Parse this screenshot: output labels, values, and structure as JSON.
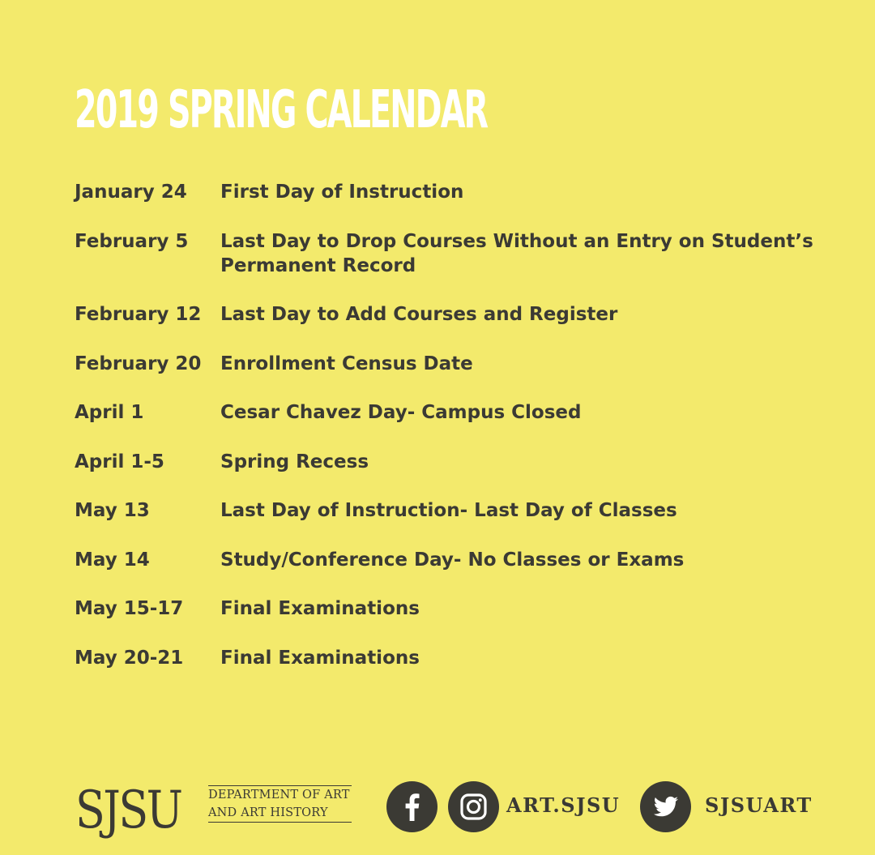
{
  "title": "2019 SPRING CALENDAR",
  "events": [
    {
      "date": "January 24",
      "desc": "First Day of Instruction"
    },
    {
      "date": "February 5",
      "desc": "Last Day to Drop Courses Without an Entry on Student’s Permanent Record"
    },
    {
      "date": "February 12",
      "desc": "Last Day to Add Courses and Register"
    },
    {
      "date": "February 20",
      "desc": "Enrollment Census Date"
    },
    {
      "date": "April 1",
      "desc": "Cesar Chavez Day- Campus Closed"
    },
    {
      "date": "April 1-5",
      "desc": "Spring Recess"
    },
    {
      "date": "May 13",
      "desc": "Last Day of Instruction- Last Day of Classes"
    },
    {
      "date": "May 14",
      "desc": "Study/Conference Day- No Classes or Exams"
    },
    {
      "date": "May 15-17",
      "desc": "Final Examinations"
    },
    {
      "date": "May 20-21",
      "desc": "Final Examinations"
    }
  ],
  "footer": {
    "logo": "SJSU",
    "dept_line1": "DEPARTMENT OF ART",
    "dept_line2": "AND ART HISTORY",
    "instagram_handle": "ART.SJSU",
    "twitter_handle": "SJSUART",
    "icons": [
      "facebook-icon",
      "instagram-icon",
      "twitter-icon"
    ]
  },
  "colors": {
    "background": "#f3ea6c",
    "text": "#3b3a34",
    "title": "#ffffff"
  }
}
